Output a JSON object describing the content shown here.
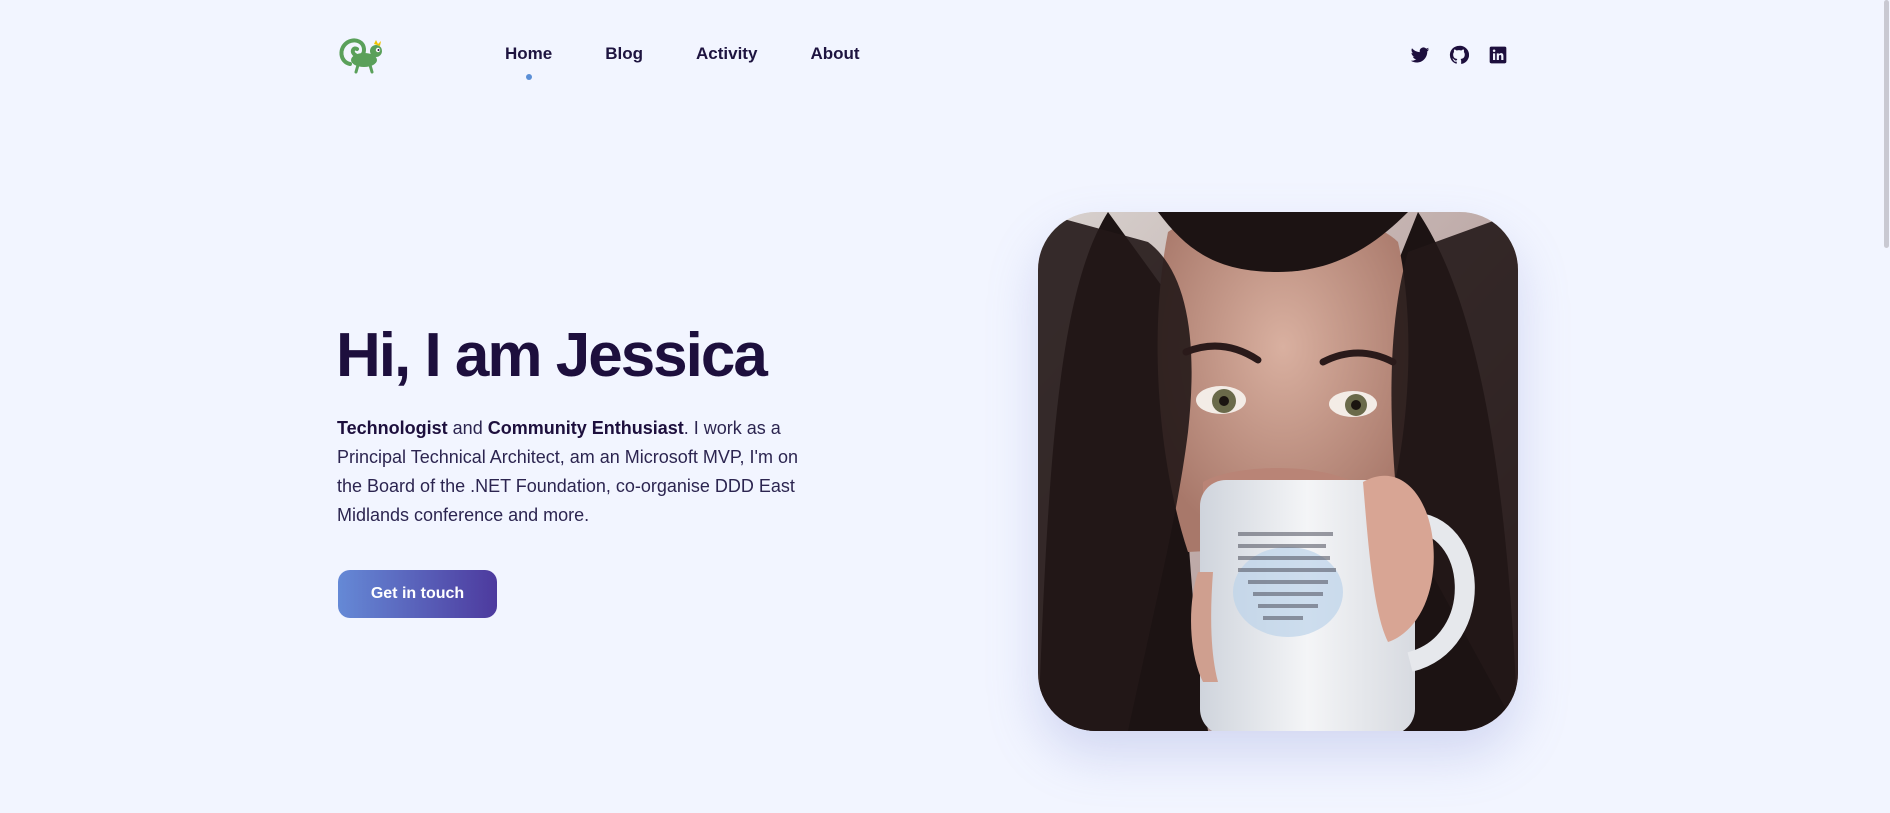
{
  "header": {
    "logo_icon": "chameleon-logo-icon",
    "nav": [
      {
        "label": "Home",
        "active": true
      },
      {
        "label": "Blog"
      },
      {
        "label": "Activity"
      },
      {
        "label": "About"
      }
    ],
    "social": [
      {
        "name": "twitter-icon"
      },
      {
        "name": "github-icon"
      },
      {
        "name": "linkedin-icon"
      }
    ]
  },
  "hero": {
    "title": "Hi, I am Jessica",
    "intro_bold_1": "Technologist",
    "intro_and": " and ",
    "intro_bold_2": "Community Enthusiast",
    "intro_rest": ". I work as a Principal Technical Architect, am an Microsoft MVP, I'm on the Board of the .NET Foundation, co-organise DDD East Midlands conference and more.",
    "cta_label": "Get in touch",
    "photo_alt": "Jessica drinking from a mug"
  },
  "colors": {
    "background": "#f2f5ff",
    "text": "#1d0f3d",
    "accent": "#5b8fd6",
    "button_gradient_start": "#6589d6",
    "button_gradient_end": "#4d3a9e"
  }
}
